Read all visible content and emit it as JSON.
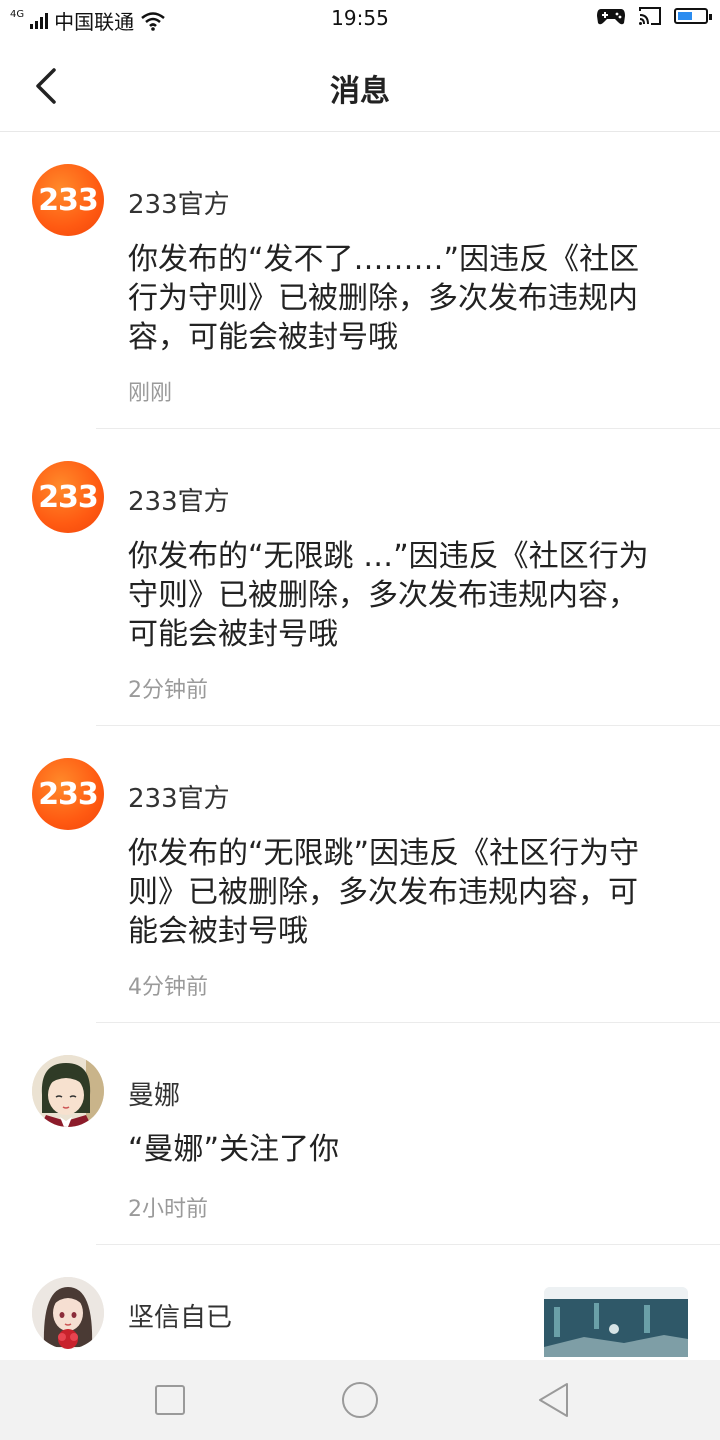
{
  "status_bar": {
    "network_tag": "4G",
    "carrier": "中国联通",
    "time": "19:55",
    "battery_level": 0.55,
    "icons": [
      "signal-icon",
      "wifi-icon",
      "gamepad-icon",
      "cast-icon",
      "battery-icon"
    ]
  },
  "header": {
    "title": "消息",
    "back_icon": "back-arrow-icon"
  },
  "messages": [
    {
      "avatar_text": "233",
      "sender": "233官方",
      "content": "你发布的“发不了………”因违反《社区行为守则》已被删除，多次发布违规内容，可能会被封号哦",
      "time": "刚刚"
    },
    {
      "avatar_text": "233",
      "sender": "233官方",
      "content": "你发布的“无限跳  …”因违反《社区行为守则》已被删除，多次发布违规内容，可能会被封号哦",
      "time": "2分钟前"
    },
    {
      "avatar_text": "233",
      "sender": "233官方",
      "content": "你发布的“无限跳”因违反《社区行为守则》已被删除，多次发布违规内容，可能会被封号哦",
      "time": "4分钟前"
    },
    {
      "sender": "曼娜",
      "content": "“曼娜”关注了你",
      "time": "2小时前"
    },
    {
      "sender": "坚信自已"
    }
  ],
  "colors": {
    "brand_orange": "#ff5a12",
    "battery_blue": "#2b8cf0",
    "time_gray": "#9a9a9a"
  }
}
